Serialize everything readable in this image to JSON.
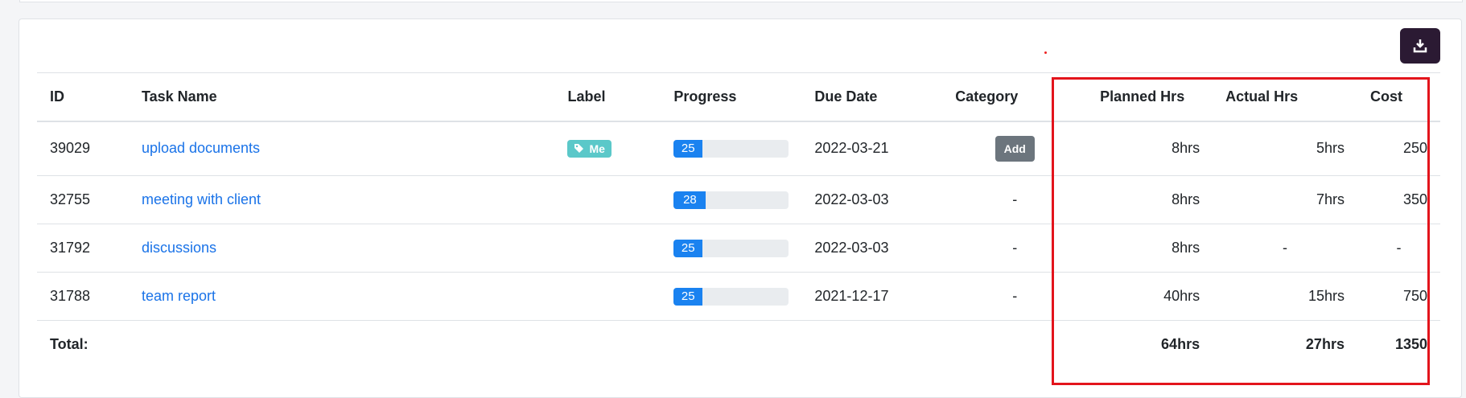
{
  "toolbar": {
    "export_icon": "download-icon"
  },
  "table": {
    "headers": {
      "id": "ID",
      "task_name": "Task Name",
      "label": "Label",
      "progress": "Progress",
      "due_date": "Due Date",
      "category": "Category",
      "planned": "Planned Hrs",
      "actual": "Actual Hrs",
      "cost": "Cost"
    },
    "rows": [
      {
        "id": "39029",
        "task": "upload documents",
        "label": "Me",
        "progress": 25,
        "progress_text": "25",
        "due": "2022-03-21",
        "category": "Add",
        "planned": "8hrs",
        "actual": "5hrs",
        "cost": "250"
      },
      {
        "id": "32755",
        "task": "meeting with client",
        "label": "",
        "progress": 28,
        "progress_text": "28",
        "due": "2022-03-03",
        "category": "-",
        "planned": "8hrs",
        "actual": "7hrs",
        "cost": "350"
      },
      {
        "id": "31792",
        "task": "discussions",
        "label": "",
        "progress": 25,
        "progress_text": "25",
        "due": "2022-03-03",
        "category": "-",
        "planned": "8hrs",
        "actual": "-",
        "cost": "-"
      },
      {
        "id": "31788",
        "task": "team report",
        "label": "",
        "progress": 25,
        "progress_text": "25",
        "due": "2021-12-17",
        "category": "-",
        "planned": "40hrs",
        "actual": "15hrs",
        "cost": "750"
      }
    ],
    "totals": {
      "label": "Total:",
      "planned": "64hrs",
      "actual": "27hrs",
      "cost": "1350"
    }
  },
  "colors": {
    "highlight": "#e3141c",
    "progress": "#1a82f0",
    "link": "#1a73e8",
    "label_tag": "#5bc8c9"
  }
}
